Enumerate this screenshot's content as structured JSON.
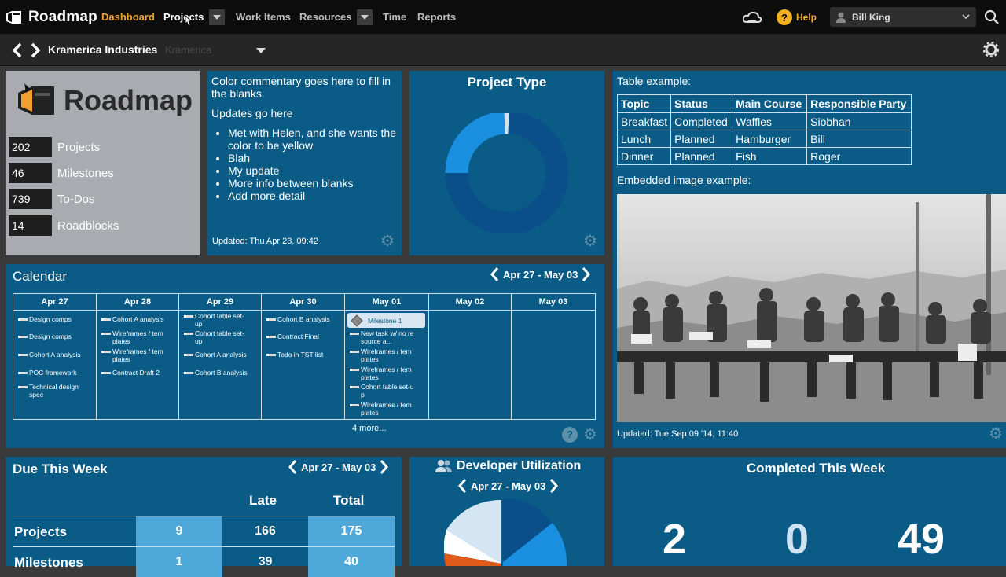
{
  "topnav": {
    "app_name": "Roadmap",
    "items": [
      "Dashboard",
      "Projects",
      "Work Items",
      "Resources",
      "Time",
      "Reports"
    ],
    "help": "Help",
    "help_icon": "?",
    "user": "Bill King"
  },
  "subnav": {
    "organization": "Kramerica Industries",
    "organization_ghost": "Kramerica"
  },
  "summary": {
    "logo_text": "Roadmap",
    "stats": [
      {
        "value": "202",
        "label": "Projects"
      },
      {
        "value": "46",
        "label": "Milestones"
      },
      {
        "value": "739",
        "label": "To-Dos"
      },
      {
        "value": "14",
        "label": "Roadblocks"
      }
    ]
  },
  "commentary": {
    "line1": "Color commentary goes here to fill in the blanks",
    "line2": "Updates go here",
    "bullets": [
      "Met with Helen, and she wants the color to be yellow",
      "Blah",
      "My update",
      "More info between blanks",
      "Add more detail"
    ],
    "updated": "Updated: Thu Apr 23, 09:42"
  },
  "project_type": {
    "title": "Project Type"
  },
  "table_example": {
    "title": "Table example:",
    "headers": [
      "Topic",
      "Status",
      "Main Course",
      "Responsible Party"
    ],
    "rows": [
      [
        "Breakfast",
        "Completed",
        "Waffles",
        "Siobhan"
      ],
      [
        "Lunch",
        "Planned",
        "Hamburger",
        "Bill"
      ],
      [
        "Dinner",
        "Planned",
        "Fish",
        "Roger"
      ]
    ],
    "image_title": "Embedded image example:",
    "updated": "Updated: Tue Sep 09 '14, 11:40"
  },
  "calendar": {
    "title": "Calendar",
    "range": "Apr 27 - May 03",
    "days": [
      "Apr 27",
      "Apr 28",
      "Apr 29",
      "Apr 30",
      "May 01",
      "May 02",
      "May 03"
    ],
    "col0": [
      "Design comps",
      "Design comps",
      "Cohort A analysis",
      "POC framework",
      "Technical design spec"
    ],
    "col1": [
      "Cohort A analysis",
      "Wireframes / tem plates",
      "Wireframes / tem plates",
      "Contract Draft 2"
    ],
    "col2": [
      "Cohort table set-up",
      "Cohort table set-up",
      "Cohort A analysis",
      "Cohort B analysis"
    ],
    "col3": [
      "Cohort B analysis",
      "Contract Final",
      "Todo in TST list"
    ],
    "milestone": "Milestone 1",
    "col4": [
      "New task w/ no re source a...",
      "Wireframes / tem plates",
      "Wireframes / tem plates",
      "Cohort table set-u p",
      "Wireframes / tem plates"
    ],
    "more": "4 more...",
    "help_icon": "?"
  },
  "due_week": {
    "title": "Due This Week",
    "range": "Apr 27 - May 03",
    "headers": [
      "Late",
      "Total"
    ],
    "rows": [
      {
        "label": "Projects",
        "a": "9",
        "late": "166",
        "total": "175"
      },
      {
        "label": "Milestones",
        "a": "1",
        "late": "39",
        "total": "40"
      }
    ]
  },
  "dev_util": {
    "title": "Developer Utilization",
    "range": "Apr 27 - May 03"
  },
  "completed": {
    "title": "Completed This Week",
    "values": [
      "2",
      "0",
      "49"
    ]
  }
}
